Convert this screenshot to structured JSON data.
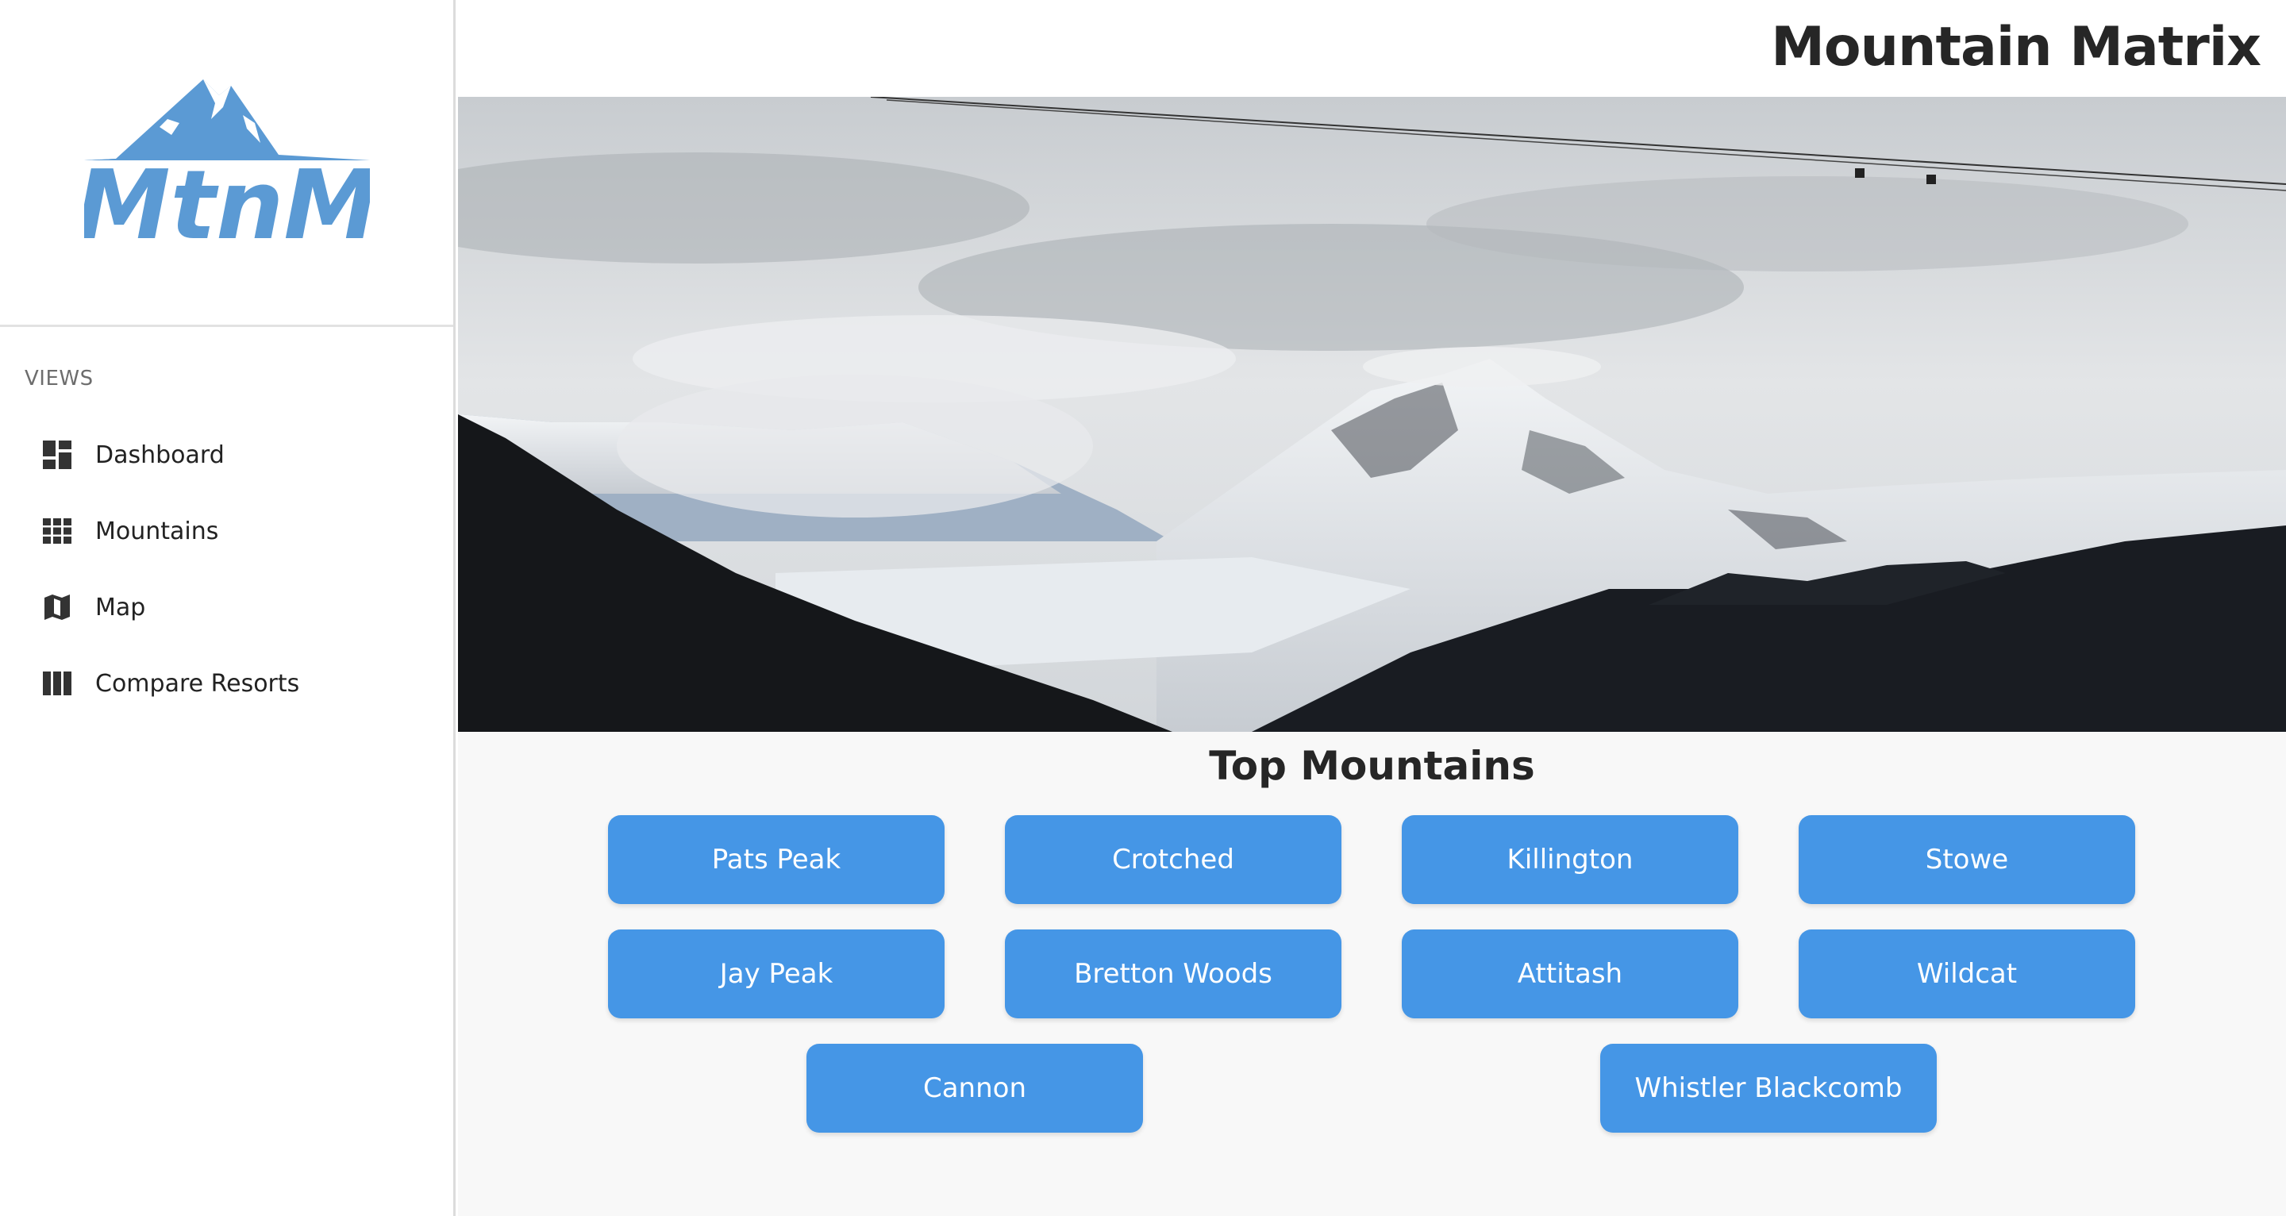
{
  "app": {
    "title": "Mountain Matrix",
    "logo_text": "MtnM",
    "brand_color": "#5b9ad4"
  },
  "sidebar": {
    "section_label": "VIEWS",
    "items": [
      {
        "label": "Dashboard",
        "icon": "dashboard-icon"
      },
      {
        "label": "Mountains",
        "icon": "grid-icon"
      },
      {
        "label": "Map",
        "icon": "map-icon"
      },
      {
        "label": "Compare Resorts",
        "icon": "columns-icon"
      }
    ]
  },
  "main": {
    "section_title": "Top Mountains",
    "button_color": "#4596e6",
    "mountains": [
      "Pats Peak",
      "Crotched",
      "Killington",
      "Stowe",
      "Jay Peak",
      "Bretton Woods",
      "Attitash",
      "Wildcat",
      "Cannon",
      "Whistler Blackcomb"
    ]
  }
}
